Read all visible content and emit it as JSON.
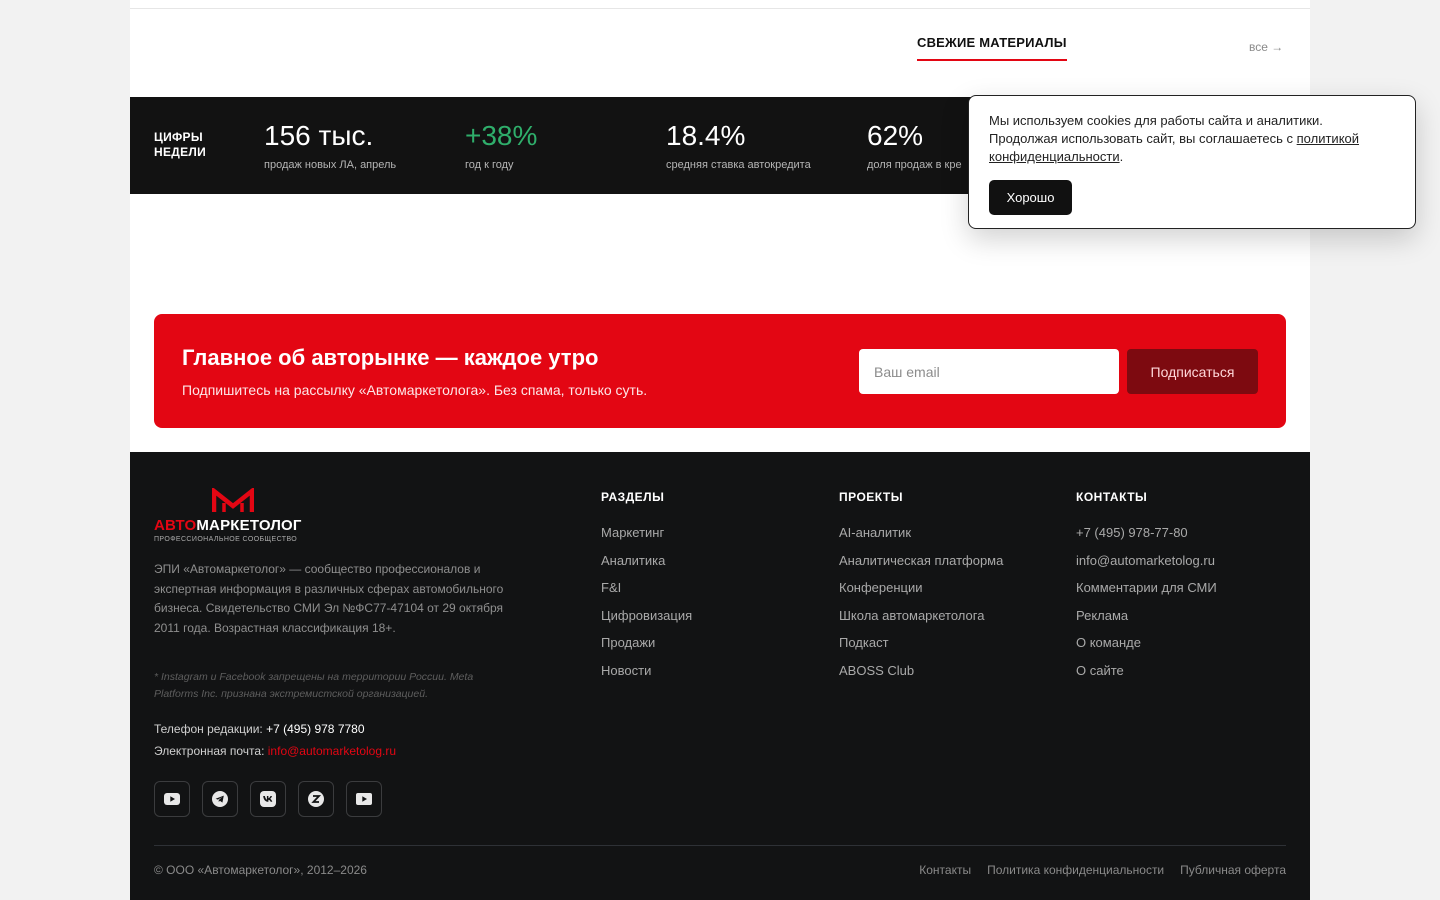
{
  "fresh": {
    "title": "СВЕЖИЕ МАТЕРИАЛЫ",
    "all_link": "все →"
  },
  "stats": {
    "label": "ЦИФРЫ НЕДЕЛИ",
    "items": [
      {
        "value": "156 тыс.",
        "caption": "продаж новых ЛА, апрель",
        "color": "#ffffff"
      },
      {
        "value": "+38%",
        "caption": "год к году",
        "color": "#2fae6b"
      },
      {
        "value": "18.4%",
        "caption": "средняя ставка автокредита",
        "color": "#ffffff"
      },
      {
        "value": "62%",
        "caption": "доля продаж в кре",
        "color": "#ffffff"
      }
    ]
  },
  "newsletter": {
    "title": "Главное об авторынке — каждое утро",
    "subtitle": "Подпишитесь на рассылку «Автомаркетолога». Без спама, только суть.",
    "email_placeholder": "Ваш email",
    "button_label": "Подписаться"
  },
  "footer": {
    "logo_word_red": "АВТО",
    "logo_word_white": "МАРКЕТОЛОГ",
    "logo_tagline": "ПРОФЕССИОНАЛЬНОЕ СООБЩЕСТВО",
    "about": "ЭПИ «Автомаркетолог» — сообщество профессионалов и экспертная информация в различных сферах автомобильного бизнеса. Свидетельство СМИ Эл №ФС77-47104 от 29 октября 2011 года. Возрастная классификация 18+.",
    "disclaimer": "* Instagram и Facebook запрещены на территории России. Meta Platforms Inc. признана экстремистской организацией.",
    "phone_label": "Телефон редакции:",
    "phone_value": "+7 (495) 978 7780",
    "email_label": "Электронная почта:",
    "email_value": "info@automarketolog.ru",
    "socials": [
      {
        "icon": "youtube-icon"
      },
      {
        "icon": "telegram-icon"
      },
      {
        "icon": "vk-icon"
      },
      {
        "icon": "zen-icon"
      },
      {
        "icon": "rutube-icon"
      }
    ],
    "columns": [
      {
        "title": "РАЗДЕЛЫ",
        "links": [
          "Маркетинг",
          "Аналитика",
          "F&I",
          "Цифровизация",
          "Продажи",
          "Новости"
        ]
      },
      {
        "title": "ПРОЕКТЫ",
        "links": [
          "AI-аналитик",
          "Аналитическая платформа",
          "Конференции",
          "Школа автомаркетолога",
          "Подкаст",
          "ABOSS Club"
        ]
      },
      {
        "title": "КОНТАКТЫ",
        "links": [
          "+7 (495) 978-77-80",
          "info@automarketolog.ru",
          "Комментарии для СМИ",
          "Реклама",
          "О команде",
          "О сайте"
        ]
      }
    ],
    "copyright": "© ООО «Автомаркетолог», 2012–2026",
    "bottom_links": [
      "Контакты",
      "Политика конфиденциальности",
      "Публичная оферта"
    ]
  },
  "cookie": {
    "text_before": "Мы используем cookies для работы сайта и аналитики. Продолжая использовать сайт, вы соглашаетесь с ",
    "link_text": "политикой конфиденциальности",
    "text_after": ".",
    "button_label": "Хорошо"
  },
  "colors": {
    "accent": "#e30613",
    "dark": "#121212",
    "positive": "#2fae6b"
  }
}
